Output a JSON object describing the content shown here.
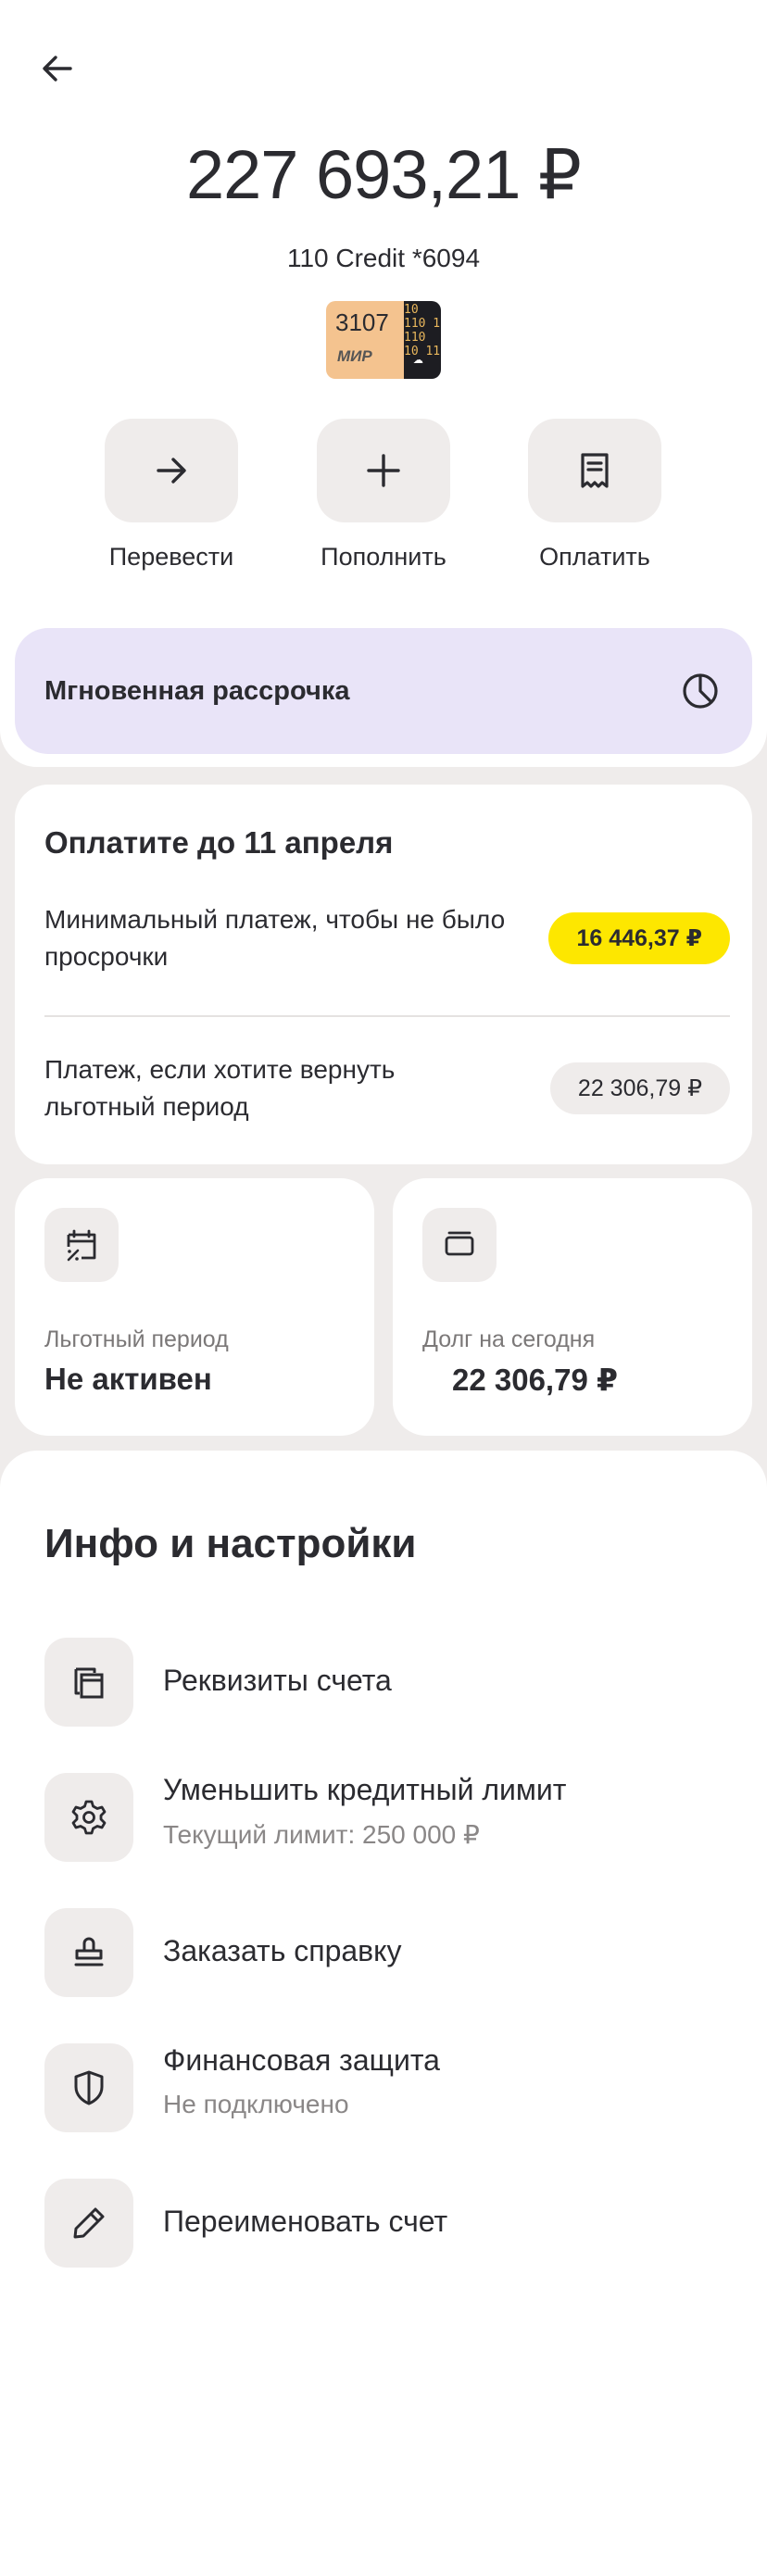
{
  "header": {
    "balance": "227 693,21 ₽",
    "account_name": "110 Credit *6094",
    "card_number_short": "3107",
    "card_brand": "МИР",
    "card_pattern": "10 110 1 110 10 11"
  },
  "actions": [
    {
      "label": "Перевести",
      "icon": "arrow-right-icon"
    },
    {
      "label": "Пополнить",
      "icon": "plus-icon"
    },
    {
      "label": "Оплатить",
      "icon": "receipt-icon"
    }
  ],
  "installment": {
    "label": "Мгновенная рассрочка",
    "icon": "pie-chart-icon"
  },
  "payment": {
    "title": "Оплатите до 11 апреля",
    "minimum_label": "Минимальный платеж, чтобы не было просрочки",
    "minimum_amount": "16 446,37 ₽",
    "grace_label": "Платеж, если хотите вернуть льготный период",
    "grace_amount": "22 306,79 ₽"
  },
  "grace_card": {
    "caption": "Льготный период",
    "value": "Не активен",
    "icon": "calendar-percent-icon"
  },
  "debt_card": {
    "caption": "Долг на сегодня",
    "value": "22 306,79 ₽",
    "icon": "card-outline-icon"
  },
  "info": {
    "title": "Инфо и настройки",
    "items": [
      {
        "label": "Реквизиты счета",
        "sub": "",
        "icon": "copy-document-icon"
      },
      {
        "label": "Уменьшить кредитный лимит",
        "sub": "Текущий лимит: 250 000 ₽",
        "icon": "gear-icon"
      },
      {
        "label": "Заказать справку",
        "sub": "",
        "icon": "stamp-icon"
      },
      {
        "label": "Финансовая защита",
        "sub": "Не подключено",
        "icon": "shield-icon"
      },
      {
        "label": "Переименовать счет",
        "sub": "",
        "icon": "pencil-icon"
      }
    ]
  },
  "colors": {
    "background": "#efeceb",
    "text": "#2b2b30",
    "installment_bg": "#e9e4f8",
    "accent_yellow": "#fde700"
  }
}
